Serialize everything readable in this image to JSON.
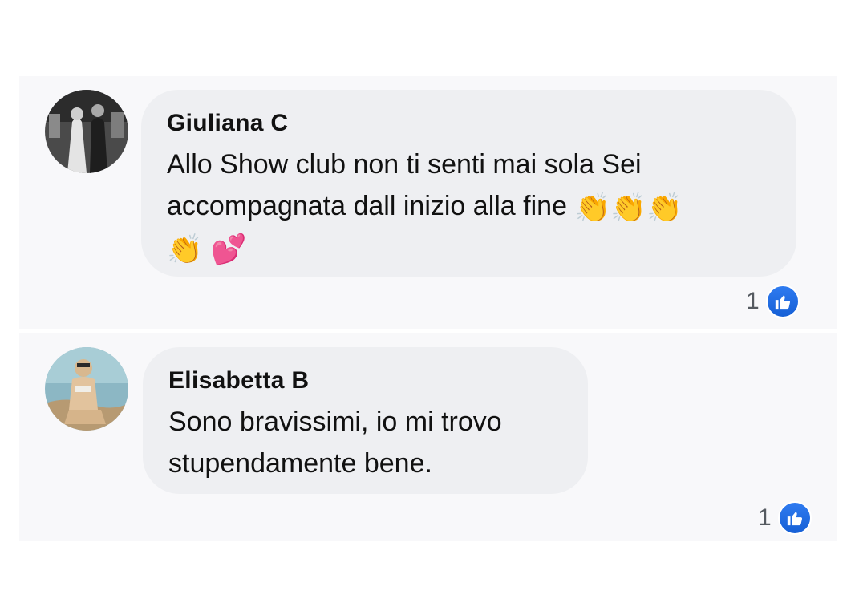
{
  "comments": [
    {
      "author": "Giuliana  C",
      "text_line1": "Allo Show club non ti senti mai sola Sei",
      "text_line2": "accompagnata dall inizio alla fine ",
      "emoji_line2": "👏👏👏",
      "emoji_line3": "👏 💕",
      "like_count": "1",
      "avatar_icon": "photo-avatar"
    },
    {
      "author": "Elisabetta B",
      "text_line1": "Sono bravissimi, io mi trovo",
      "text_line2": "stupendamente bene.",
      "like_count": "1",
      "avatar_icon": "photo-avatar"
    }
  ],
  "colors": {
    "bubble": "#eeeff2",
    "like_blue": "#1877f2",
    "text": "#111111",
    "count": "#555a60"
  }
}
